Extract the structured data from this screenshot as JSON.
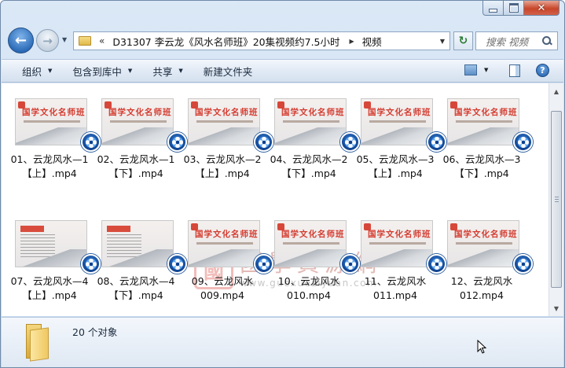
{
  "window": {
    "close_glyph": "✕"
  },
  "nav": {
    "back_glyph": "←",
    "forward_glyph": "→",
    "dropdown_glyph": "▼"
  },
  "address": {
    "chevron": "«",
    "path": "D31307 李云龙《风水名师班》20集视频约7.5小时",
    "separator": "▶",
    "current": "视频",
    "dropdown_glyph": "▼"
  },
  "refresh_glyph": "↻",
  "search": {
    "placeholder": "搜索 视频"
  },
  "commands": {
    "organize": "组织",
    "include_in_library": "包含到库中",
    "share": "共享",
    "new_folder": "新建文件夹",
    "dropdown_glyph": "▼",
    "help_glyph": "?"
  },
  "thumbnail": {
    "title": "国学文化名师班"
  },
  "files": [
    {
      "line1": "01、云龙风水—1",
      "line2": "【上】.mp4",
      "thumb": "title"
    },
    {
      "line1": "02、云龙风水—1",
      "line2": "【下】.mp4",
      "thumb": "title"
    },
    {
      "line1": "03、云龙风水—2",
      "line2": "【上】.mp4",
      "thumb": "title"
    },
    {
      "line1": "04、云龙风水—2",
      "line2": "【下】.mp4",
      "thumb": "title"
    },
    {
      "line1": "05、云龙风水—3",
      "line2": "【上】.mp4",
      "thumb": "title"
    },
    {
      "line1": "06、云龙风水—3",
      "line2": "【下】.mp4",
      "thumb": "title"
    },
    {
      "line1": "07、云龙风水—4",
      "line2": "【上】.mp4",
      "thumb": "text"
    },
    {
      "line1": "08、云龙风水—4",
      "line2": "【下】.mp4",
      "thumb": "text"
    },
    {
      "line1": "09、云龙风水",
      "line2": "009.mp4",
      "thumb": "title"
    },
    {
      "line1": "10、云龙风水",
      "line2": "010.mp4",
      "thumb": "title"
    },
    {
      "line1": "11、云龙风水",
      "line2": "011.mp4",
      "thumb": "title"
    },
    {
      "line1": "12、云龙风水",
      "line2": "012.mp4",
      "thumb": "title"
    }
  ],
  "watermark": {
    "seal": "國",
    "name": "國學資源網",
    "url": "www.guoxueziyuan.com"
  },
  "scrollbar": {
    "up_glyph": "▲",
    "down_glyph": "▼"
  },
  "details": {
    "count": "20 个对象"
  }
}
